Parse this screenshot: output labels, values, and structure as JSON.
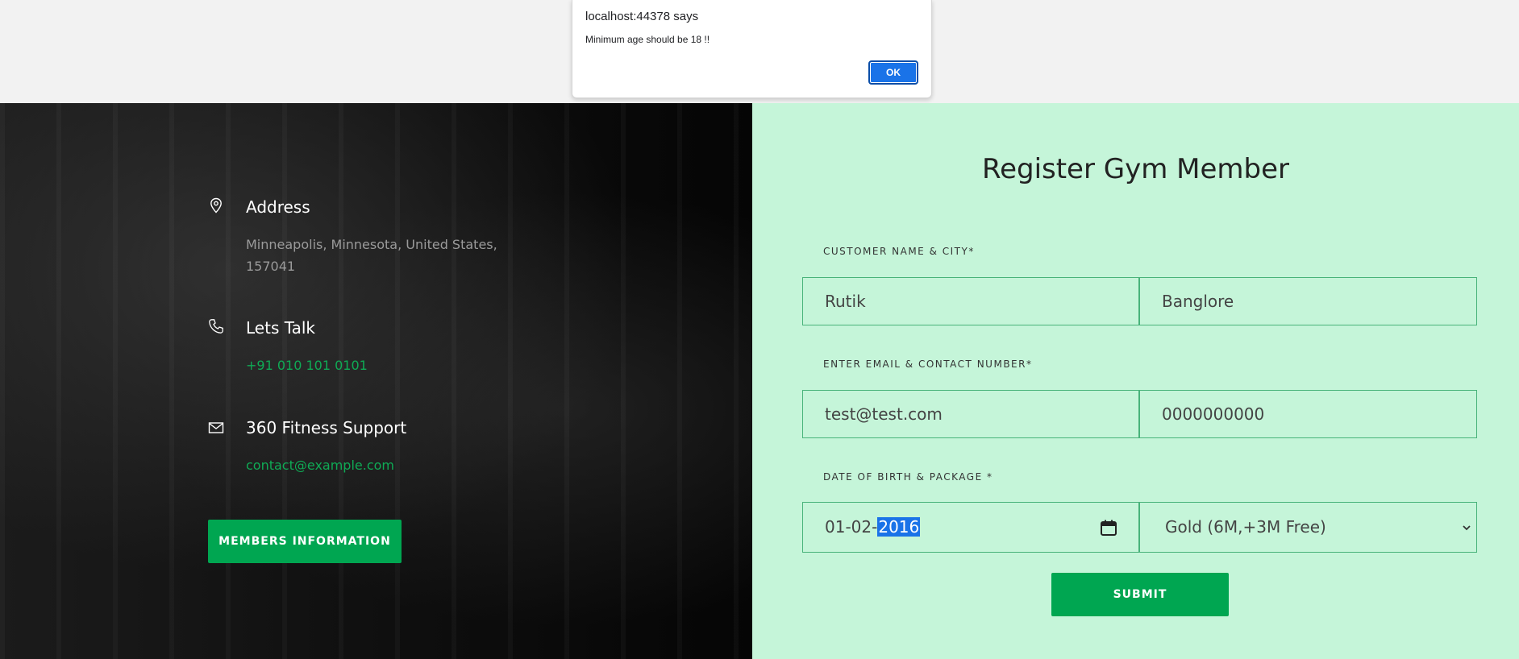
{
  "alert": {
    "title": "localhost:44378 says",
    "message": "Minimum age should be 18 !!",
    "ok_label": "OK"
  },
  "contact": {
    "address": {
      "icon": "location-pin-icon",
      "title": "Address",
      "line1": "Minneapolis, Minnesota, United States,",
      "line2": "157041"
    },
    "talk": {
      "icon": "phone-icon",
      "title": "Lets Talk",
      "phone": "+91 010 101 0101"
    },
    "support": {
      "icon": "envelope-icon",
      "title": "360 Fitness Support",
      "email": "contact@example.com"
    },
    "members_button": "MEMBERS INFORMATION"
  },
  "form": {
    "title": "Register Gym Member",
    "name_city_label": "CUSTOMER NAME & CITY*",
    "name_value": "Rutik",
    "city_value": "Banglore",
    "email_contact_label": "ENTER EMAIL & CONTACT NUMBER*",
    "email_value": "test@test.com",
    "contact_value": "0000000000",
    "dob_package_label": "DATE OF BIRTH & PACKAGE *",
    "dob_prefix": "01-02-",
    "dob_year": "2016",
    "package_value": "Gold (6M,+3M Free)",
    "submit_label": "SUBMIT"
  },
  "colors": {
    "accent_green": "#00a651",
    "form_background": "#c5f5d9",
    "dialog_button": "#1a73e8"
  }
}
